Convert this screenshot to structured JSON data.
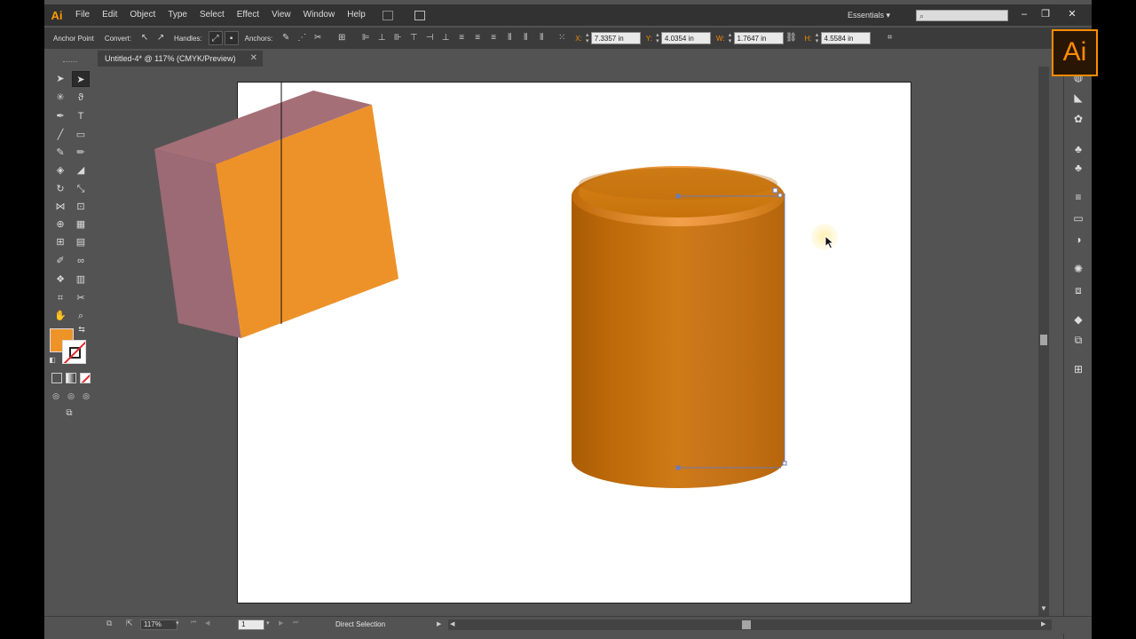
{
  "app": {
    "logo_small": "Ai",
    "logo_big": "Ai"
  },
  "menubar": {
    "items": [
      "File",
      "Edit",
      "Object",
      "Type",
      "Select",
      "Effect",
      "View",
      "Window",
      "Help"
    ],
    "workspace": "Essentials",
    "search_placeholder": ""
  },
  "controlbar": {
    "anchor_point_label": "Anchor Point",
    "convert_label": "Convert:",
    "handles_label": "Handles:",
    "anchors_label": "Anchors:",
    "x_label": "X:",
    "x_value": "7.3357 in",
    "y_label": "Y:",
    "y_value": "4.0354 in",
    "w_label": "W:",
    "w_value": "1.7647 in",
    "h_label": "H:",
    "h_value": "4.5584 in"
  },
  "document": {
    "tab_title": "Untitled-4* @ 117% (CMYK/Preview)"
  },
  "tools": {
    "fill_color": "#ee9328",
    "stroke": "none"
  },
  "artwork": {
    "box_front_color": "#ed9229",
    "box_side_color": "#9e6a73",
    "box_top_color": "#a8707a",
    "cylinder_body_color": "#c46f0c",
    "cylinder_top_color": "#cf7c17",
    "selection_color": "#6a7bb5"
  },
  "statusbar": {
    "zoom": "117%",
    "page": "1",
    "tool_name": "Direct Selection"
  }
}
